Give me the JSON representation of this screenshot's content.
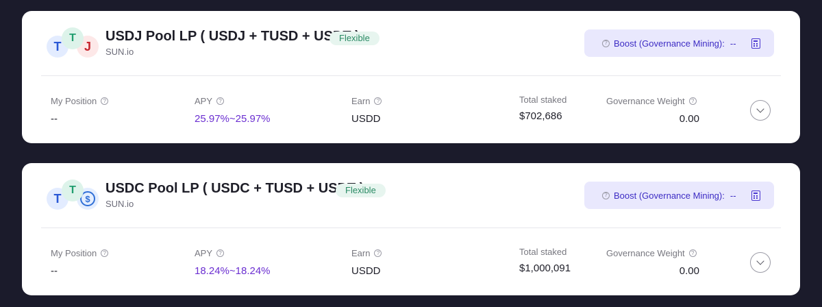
{
  "pools": [
    {
      "title": "USDJ Pool LP ( USDJ + TUSD + USDT )",
      "badge": "Flexible",
      "subtitle": "SUN.io",
      "tokens": [
        "tusd-icon",
        "usdt-icon",
        "usdj-icon"
      ],
      "token_glyphs": [
        "T",
        "T",
        "J"
      ],
      "boost_label": "Boost (Governance Mining):",
      "boost_value": "--",
      "stats": {
        "position_label": "My Position",
        "position_value": "--",
        "apy_label": "APY",
        "apy_value": "25.97%~25.97%",
        "earn_label": "Earn",
        "earn_value": "USDD",
        "total_label": "Total staked",
        "total_value": "$702,686",
        "gov_label": "Governance Weight",
        "gov_value": "0.00"
      }
    },
    {
      "title": "USDC Pool LP ( USDC + TUSD + USDT )",
      "badge": "Flexible",
      "subtitle": "SUN.io",
      "tokens": [
        "tusd-icon",
        "usdt-icon",
        "usdc-icon"
      ],
      "token_glyphs": [
        "T",
        "T",
        "$"
      ],
      "boost_label": "Boost (Governance Mining):",
      "boost_value": "--",
      "stats": {
        "position_label": "My Position",
        "position_value": "--",
        "apy_label": "APY",
        "apy_value": "18.24%~18.24%",
        "earn_label": "Earn",
        "earn_value": "USDD",
        "total_label": "Total staked",
        "total_value": "$1,000,091",
        "gov_label": "Governance Weight",
        "gov_value": "0.00"
      }
    }
  ],
  "colors": {
    "accent": "#6b2fd1",
    "boost_bg": "#e9e8fd",
    "badge_bg": "#e7f5ef",
    "page_bg": "#1b1b2b"
  }
}
